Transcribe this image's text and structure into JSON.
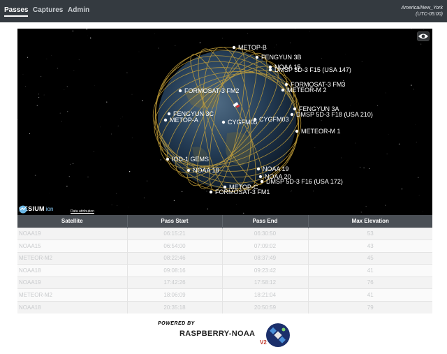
{
  "nav": {
    "links": [
      "Passes",
      "Captures",
      "Admin"
    ],
    "timezone_line1": "America/New_York",
    "timezone_line2": "(UTC-05:00)"
  },
  "globe": {
    "satellite_labels": [
      "METOP-B",
      "FENGYUN 3B",
      "NOAA 15",
      "DMSP 5D-3 F15 (USA 147)",
      "FORMOSAT-3 FM3",
      "METEOR-M 2",
      "FORMOSAT-3 FM2",
      "FENGYUN 3A",
      "DMSP 5D-3 F18 (USA 210)",
      "FENGYUN 3C",
      "METOP-A",
      "CYGFM05",
      "CYGFM03",
      "METEOR-M 1",
      "IOD-1 GEMS",
      "NOAA 18",
      "NOAA 19",
      "NOAA 20",
      "DMSP 5D-3 F16 (USA 172)",
      "METOP-C",
      "FORMOSAT-3 FM1"
    ],
    "cesium_text": "CESIUM",
    "cesium_ion": "ion",
    "attribution": "Data attribution"
  },
  "table": {
    "headers": [
      "Satellite",
      "Pass Start",
      "Pass End",
      "Max Elevation"
    ],
    "rows": [
      [
        "NOAA19",
        "06:15:21",
        "06:30:50",
        "53"
      ],
      [
        "NOAA15",
        "06:54:00",
        "07:09:02",
        "43"
      ],
      [
        "METEOR-M2",
        "08:22:46",
        "08:37:49",
        "45"
      ],
      [
        "NOAA18",
        "09:08:16",
        "09:23:42",
        "41"
      ],
      [
        "NOAA19",
        "17:42:26",
        "17:58:12",
        "76"
      ],
      [
        "METEOR-M2",
        "18:06:09",
        "18:21:04",
        "41"
      ],
      [
        "NOAA18",
        "20:35:18",
        "20:50:59",
        "79"
      ]
    ]
  },
  "footer": {
    "powered_by": "POWERED BY",
    "brand": "RASPBERRY-NOAA",
    "version": "V2"
  },
  "colors": {
    "navbar": "#343a40",
    "orbit": "#c8a33a",
    "ocean": "#1f3a55"
  }
}
